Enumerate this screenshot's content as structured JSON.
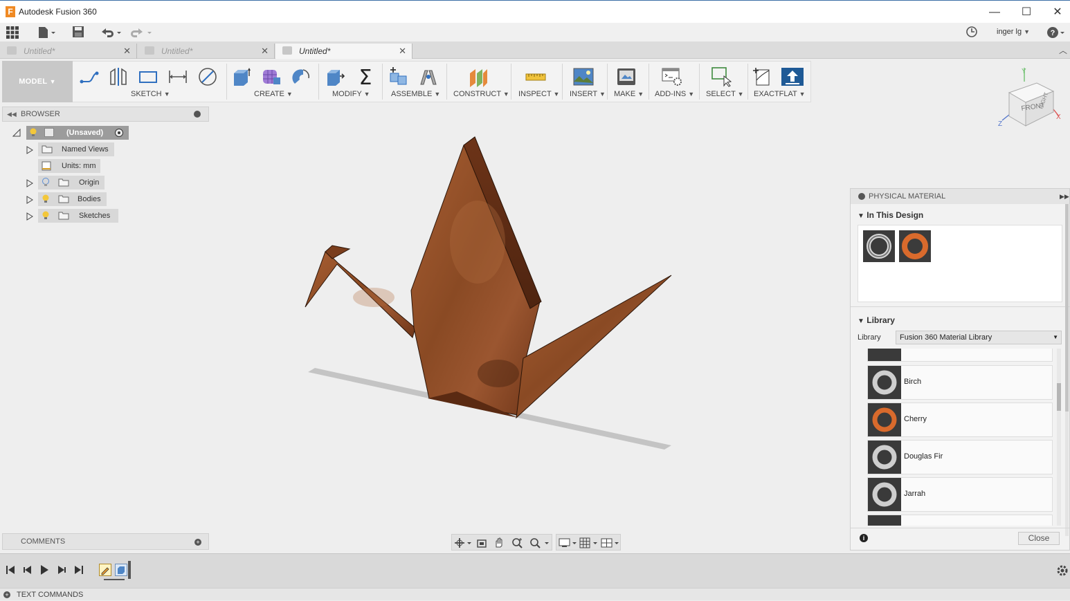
{
  "window": {
    "title": "Autodesk Fusion 360",
    "logo_letter": "F"
  },
  "quick_access": {
    "user": "inger lg"
  },
  "tabs": [
    {
      "label": "Untitled*"
    },
    {
      "label": "Untitled*"
    },
    {
      "label": "Untitled*"
    }
  ],
  "ribbon": {
    "workspace": "MODEL",
    "groups": [
      "SKETCH",
      "CREATE",
      "MODIFY",
      "ASSEMBLE",
      "CONSTRUCT",
      "INSPECT",
      "INSERT",
      "MAKE",
      "ADD-INS",
      "SELECT",
      "EXACTFLAT"
    ]
  },
  "browser": {
    "title": "BROWSER",
    "root": "(Unsaved)",
    "items": [
      {
        "label": "Named Views"
      },
      {
        "label": "Units: mm"
      },
      {
        "label": "Origin"
      },
      {
        "label": "Bodies"
      },
      {
        "label": "Sketches"
      }
    ]
  },
  "viewcube": {
    "front": "FRONT",
    "right": "RIGHT",
    "x": "X",
    "y": "Y",
    "z": "Z"
  },
  "material_panel": {
    "title": "PHYSICAL MATERIAL",
    "in_design": "In This Design",
    "library_section": "Library",
    "library_label": "Library",
    "library_value": "Fusion 360 Material Library",
    "materials": [
      {
        "name": "Birch"
      },
      {
        "name": "Cherry"
      },
      {
        "name": "Douglas Fir"
      },
      {
        "name": "Jarrah"
      }
    ],
    "close": "Close"
  },
  "comments": {
    "title": "COMMENTS"
  },
  "text_commands": {
    "title": "TEXT COMMANDS"
  },
  "colors": {
    "wood": "#8a4a24",
    "cherry_orange": "#d96a2c",
    "browser_blue": "#3a6ea5"
  }
}
